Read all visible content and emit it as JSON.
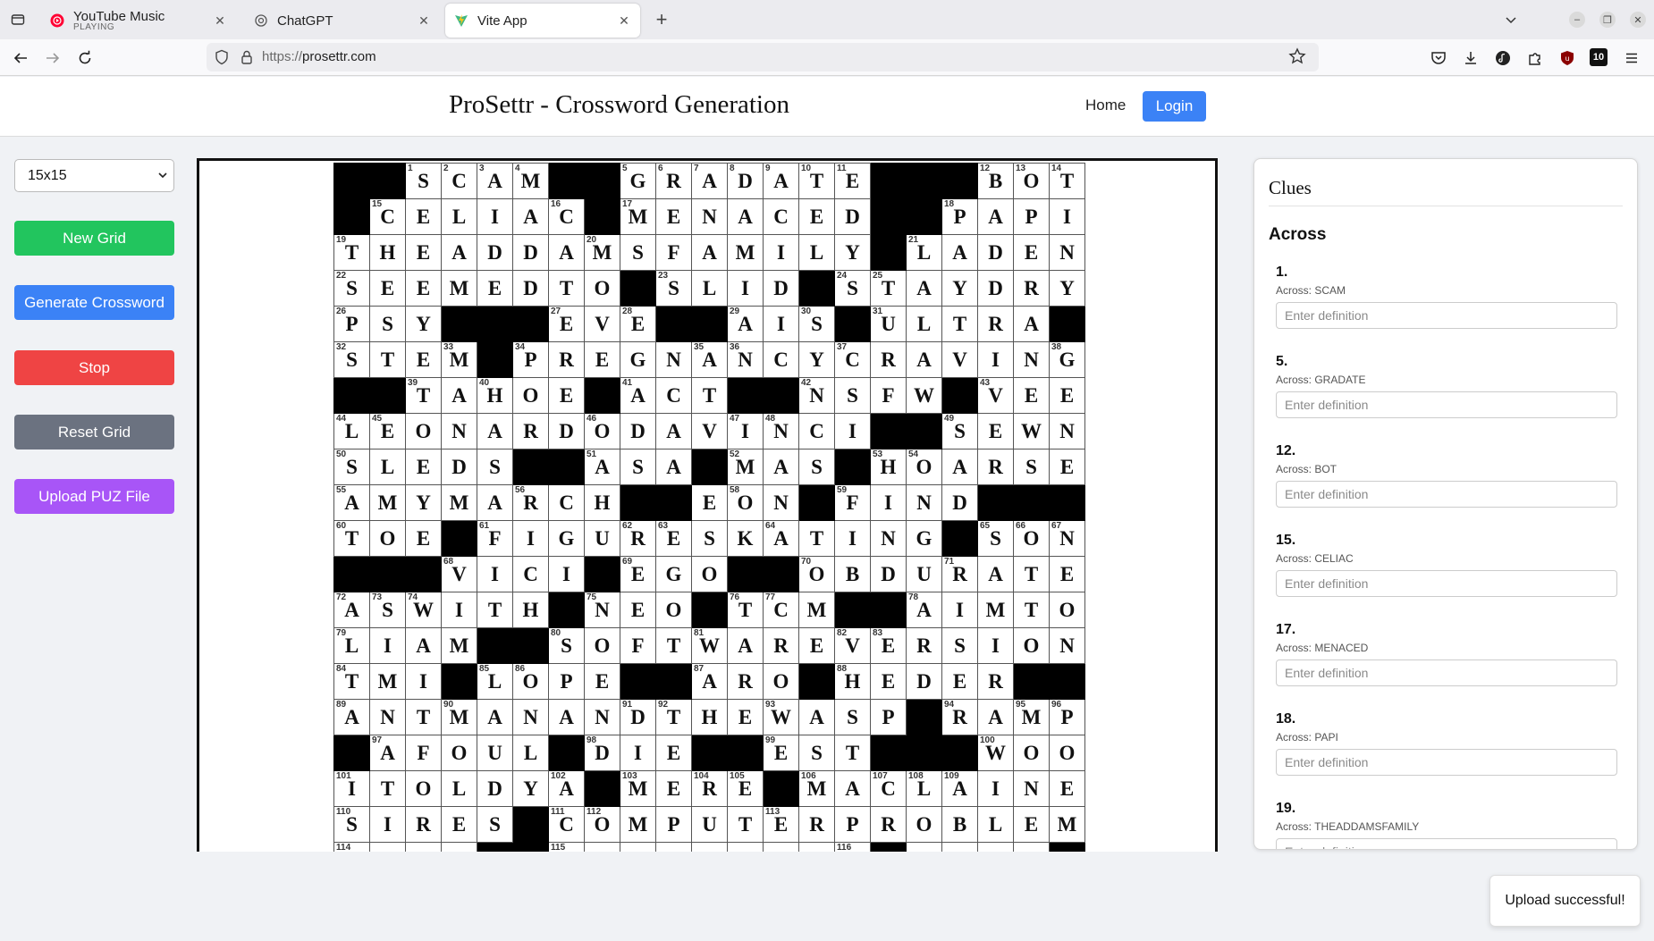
{
  "browser": {
    "tabs": [
      {
        "title": "YouTube Music",
        "subtitle": "PLAYING",
        "icon": "youtube-music-icon",
        "active": false
      },
      {
        "title": "ChatGPT",
        "subtitle": "",
        "icon": "chatgpt-icon",
        "active": false
      },
      {
        "title": "Vite App",
        "subtitle": "",
        "icon": "vite-icon",
        "active": true
      }
    ],
    "url_scheme": "https://",
    "url_host": "prosettr.com",
    "extension_badge": "10"
  },
  "header": {
    "title": "ProSettr - Crossword Generation",
    "home_label": "Home",
    "login_label": "Login"
  },
  "controls": {
    "size_selected": "15x15",
    "new_grid_label": "New Grid",
    "generate_label": "Generate Crossword",
    "stop_label": "Stop",
    "reset_label": "Reset Grid",
    "upload_label": "Upload PUZ File",
    "colors": {
      "green": "#22c55e",
      "blue": "#3b82f6",
      "red": "#ef4444",
      "gray": "#6b7280",
      "purple": "#a855f7"
    }
  },
  "grid": {
    "rows": [
      "##SCAM##GRADATE###BOT",
      "#CELIAC#MENACED##PAPI",
      "THEADDAMSFAMILY#LADEN",
      "SEEMEDTO#SLID#STAYDRY",
      "PSY###EVE##AIS#ULTRA#",
      "STEM#PREGNANCYCRAVING",
      "##TAHOE#ACT##NSFW#VEE",
      "LEONARDODAVINCI##SEWN",
      "SLEDS##ASA#MAS#HOARSE",
      "AMYMARCH##EON#FIND###",
      "TOE#FIGURESKATING#SON",
      "###VICI#EGO##OBDURATE",
      "ASWITH#NEO#TCM##AIMTO",
      "LIAM##SOFTWAREVERSION",
      "TMI#LOPE##ARO#HEDER##",
      "ANTMANANDTHEWASP#RAMP",
      "#AFOUL#DIE##EST###WOO",
      "ITOLDYA#MERE#MACLAINE",
      "SIRES#COMPUTERPROBLEM",
      "....##.........#....#"
    ],
    "numbers": [
      [
        0,
        2,
        1
      ],
      [
        0,
        3,
        2
      ],
      [
        0,
        4,
        3
      ],
      [
        0,
        5,
        4
      ],
      [
        0,
        8,
        5
      ],
      [
        0,
        9,
        6
      ],
      [
        0,
        10,
        7
      ],
      [
        0,
        11,
        8
      ],
      [
        0,
        12,
        9
      ],
      [
        0,
        13,
        10
      ],
      [
        0,
        14,
        11
      ],
      [
        0,
        18,
        12
      ],
      [
        0,
        19,
        13
      ],
      [
        0,
        20,
        14
      ],
      [
        1,
        1,
        15
      ],
      [
        1,
        6,
        16
      ],
      [
        1,
        8,
        17
      ],
      [
        1,
        17,
        18
      ],
      [
        2,
        0,
        19
      ],
      [
        2,
        7,
        20
      ],
      [
        2,
        16,
        21
      ],
      [
        3,
        0,
        22
      ],
      [
        3,
        9,
        23
      ],
      [
        3,
        14,
        24
      ],
      [
        3,
        15,
        25
      ],
      [
        4,
        0,
        26
      ],
      [
        4,
        6,
        27
      ],
      [
        4,
        8,
        28
      ],
      [
        4,
        11,
        29
      ],
      [
        4,
        13,
        30
      ],
      [
        4,
        15,
        31
      ],
      [
        5,
        0,
        32
      ],
      [
        5,
        3,
        33
      ],
      [
        5,
        5,
        34
      ],
      [
        5,
        10,
        35
      ],
      [
        5,
        11,
        36
      ],
      [
        5,
        14,
        37
      ],
      [
        5,
        20,
        38
      ],
      [
        6,
        2,
        39
      ],
      [
        6,
        4,
        40
      ],
      [
        6,
        8,
        41
      ],
      [
        6,
        13,
        42
      ],
      [
        6,
        18,
        43
      ],
      [
        7,
        0,
        44
      ],
      [
        7,
        1,
        45
      ],
      [
        7,
        7,
        46
      ],
      [
        7,
        11,
        47
      ],
      [
        7,
        12,
        48
      ],
      [
        7,
        17,
        49
      ],
      [
        8,
        0,
        50
      ],
      [
        8,
        7,
        51
      ],
      [
        8,
        11,
        52
      ],
      [
        8,
        15,
        53
      ],
      [
        8,
        16,
        54
      ],
      [
        9,
        0,
        55
      ],
      [
        9,
        5,
        56
      ],
      [
        9,
        11,
        58
      ],
      [
        9,
        14,
        59
      ],
      [
        10,
        0,
        60
      ],
      [
        10,
        4,
        61
      ],
      [
        10,
        8,
        62
      ],
      [
        10,
        9,
        63
      ],
      [
        10,
        12,
        64
      ],
      [
        10,
        18,
        65
      ],
      [
        10,
        19,
        66
      ],
      [
        10,
        20,
        67
      ],
      [
        11,
        3,
        68
      ],
      [
        11,
        8,
        69
      ],
      [
        11,
        13,
        70
      ],
      [
        11,
        17,
        71
      ],
      [
        12,
        0,
        72
      ],
      [
        12,
        1,
        73
      ],
      [
        12,
        2,
        74
      ],
      [
        12,
        7,
        75
      ],
      [
        12,
        11,
        76
      ],
      [
        12,
        12,
        77
      ],
      [
        12,
        16,
        78
      ],
      [
        13,
        0,
        79
      ],
      [
        13,
        6,
        80
      ],
      [
        13,
        10,
        81
      ],
      [
        13,
        14,
        82
      ],
      [
        13,
        15,
        83
      ],
      [
        14,
        0,
        84
      ],
      [
        14,
        4,
        85
      ],
      [
        14,
        5,
        86
      ],
      [
        14,
        10,
        87
      ],
      [
        14,
        14,
        88
      ],
      [
        15,
        0,
        89
      ],
      [
        15,
        3,
        90
      ],
      [
        15,
        8,
        91
      ],
      [
        15,
        9,
        92
      ],
      [
        15,
        12,
        93
      ],
      [
        15,
        17,
        94
      ],
      [
        15,
        19,
        95
      ],
      [
        15,
        20,
        96
      ],
      [
        16,
        1,
        97
      ],
      [
        16,
        7,
        98
      ],
      [
        16,
        12,
        99
      ],
      [
        16,
        18,
        100
      ],
      [
        17,
        0,
        101
      ],
      [
        17,
        6,
        102
      ],
      [
        17,
        8,
        103
      ],
      [
        17,
        10,
        104
      ],
      [
        17,
        11,
        105
      ],
      [
        17,
        13,
        106
      ],
      [
        17,
        15,
        107
      ],
      [
        17,
        16,
        108
      ],
      [
        17,
        17,
        109
      ],
      [
        18,
        0,
        110
      ],
      [
        18,
        6,
        111
      ],
      [
        18,
        7,
        112
      ],
      [
        18,
        12,
        113
      ],
      [
        19,
        0,
        114
      ],
      [
        19,
        6,
        115
      ],
      [
        19,
        14,
        116
      ]
    ]
  },
  "clues": {
    "title": "Clues",
    "across_heading": "Across",
    "placeholder": "Enter definition",
    "items": [
      {
        "num": "1.",
        "answer": "Across: SCAM"
      },
      {
        "num": "5.",
        "answer": "Across: GRADATE"
      },
      {
        "num": "12.",
        "answer": "Across: BOT"
      },
      {
        "num": "15.",
        "answer": "Across: CELIAC"
      },
      {
        "num": "17.",
        "answer": "Across: MENACED"
      },
      {
        "num": "18.",
        "answer": "Across: PAPI"
      },
      {
        "num": "19.",
        "answer": "Across: THEADDAMSFAMILY"
      }
    ]
  },
  "toast": {
    "message": "Upload successful!"
  }
}
